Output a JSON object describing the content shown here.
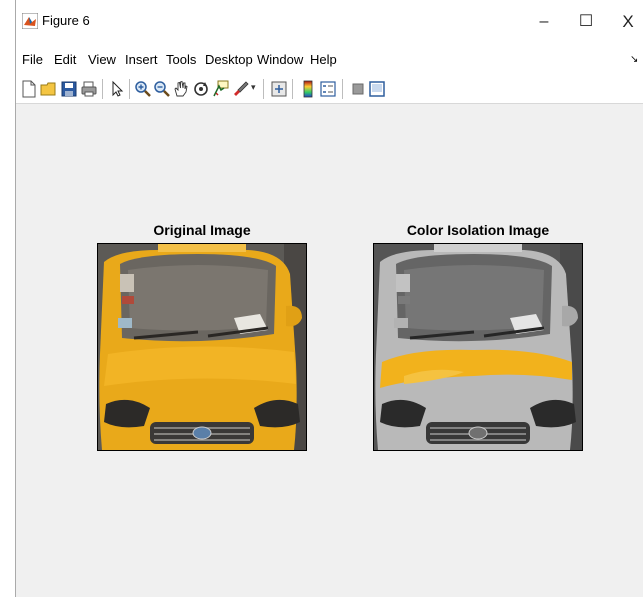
{
  "window": {
    "title": "Figure 6",
    "controls": {
      "minimize": "–",
      "maximize": "☐",
      "close": "X"
    }
  },
  "menu": {
    "items": [
      "File",
      "Edit",
      "View",
      "Insert",
      "Tools",
      "Desktop",
      "Window",
      "Help"
    ],
    "dock_icon": "↘"
  },
  "toolbar": {
    "icons": [
      "new-figure-icon",
      "open-file-icon",
      "save-icon",
      "print-icon",
      "edit-plot-icon",
      "zoom-in-icon",
      "zoom-out-icon",
      "pan-icon",
      "rotate-3d-icon",
      "data-cursor-icon",
      "brush-icon",
      "link-plot-icon",
      "insert-colorbar-icon",
      "insert-legend-icon",
      "hide-plot-tools-icon",
      "show-plot-tools-icon"
    ]
  },
  "figure": {
    "left_title": "Original Image",
    "right_title": "Color Isolation Image"
  },
  "colors": {
    "taxi_yellow": "#f2b21c",
    "gray_body": "#c9c9c9"
  }
}
